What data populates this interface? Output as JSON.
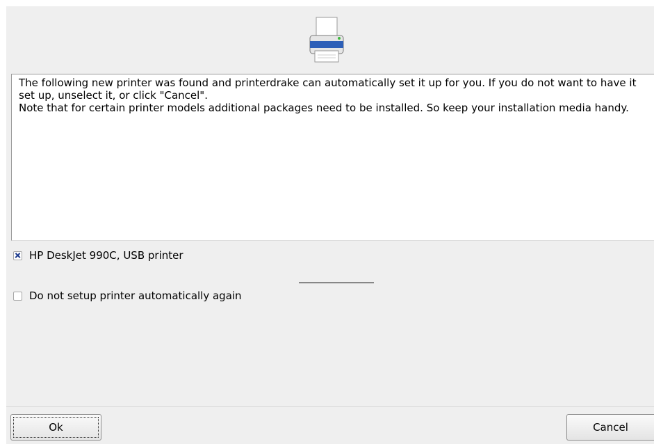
{
  "icons": {
    "header": "printer-icon"
  },
  "message": {
    "line1": "The following new printer was found and printerdrake can automatically set it up for you. If you do not want to have it set up, unselect it, or click \"Cancel\".",
    "line2": "Note that for certain printer models additional packages need to be installed. So keep your installation media handy."
  },
  "options": [
    {
      "label": "HP DeskJet 990C, USB printer",
      "checked": true
    },
    {
      "label": "Do not setup printer automatically again",
      "checked": false
    }
  ],
  "buttons": {
    "ok_label": "Ok",
    "cancel_label": "Cancel"
  },
  "colors": {
    "dialog_bg": "#efefef",
    "checkmark": "#1f3d8f",
    "printer_paper_tray": "#2d5fb8"
  }
}
